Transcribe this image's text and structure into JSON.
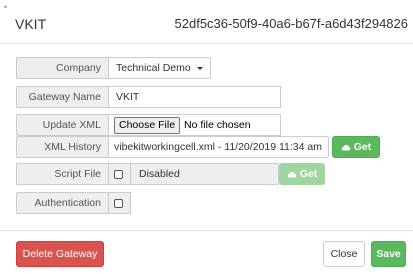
{
  "header": {
    "title": "VKIT",
    "gateway_id": "52df5c36-50f9-40a6-b67f-a6d43f294826",
    "corner_mark": "•"
  },
  "form": {
    "company": {
      "label": "Company",
      "value": "Technical Demo"
    },
    "gateway_name": {
      "label": "Gateway Name",
      "value": "VKIT"
    },
    "update_xml": {
      "label": "Update XML",
      "choose_label": "Choose File",
      "file_status": "No file chosen"
    },
    "xml_history": {
      "label": "XML History",
      "selected": "vibekitworkingcell.xml - 11/20/2019 11:34 am",
      "get_label": "Get"
    },
    "script_file": {
      "label": "Script File",
      "status": "Disabled",
      "get_label": "Get"
    },
    "authentication": {
      "label": "Authentication"
    }
  },
  "footer": {
    "delete_label": "Delete Gateway",
    "close_label": "Close",
    "save_label": "Save"
  },
  "colors": {
    "danger": "#d9534f",
    "success": "#5cb85c",
    "success_disabled": "#9fd59f"
  }
}
